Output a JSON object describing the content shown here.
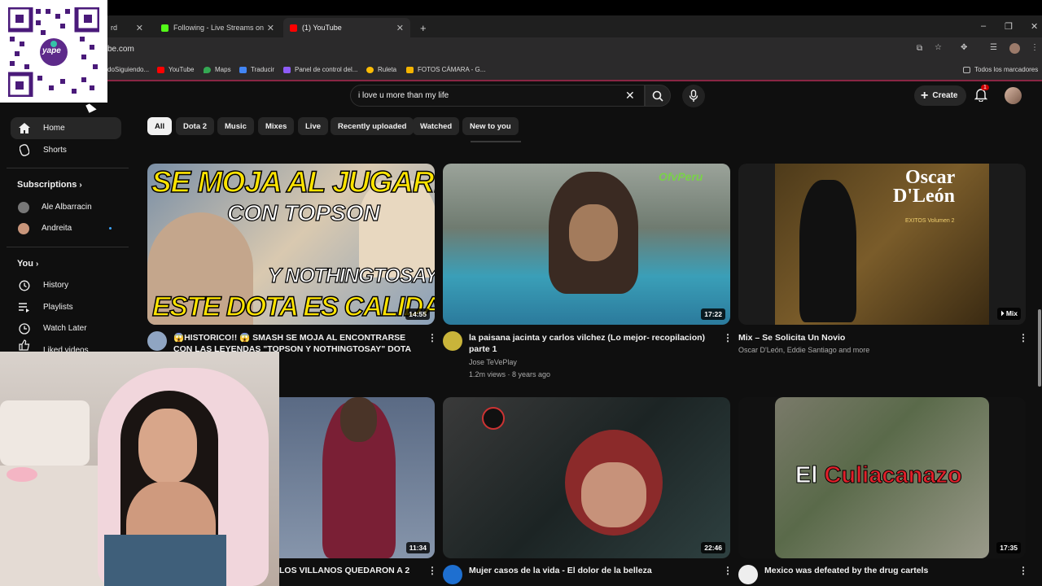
{
  "browser": {
    "tabs": [
      {
        "label": "rd",
        "active": false
      },
      {
        "label": "Following - Live Streams on Kic",
        "active": false
      },
      {
        "label": "(1) YouTube",
        "active": true
      }
    ],
    "new_tab": "+",
    "url": "be.com",
    "bookmarks": [
      {
        "label": "doSiguiendo...",
        "color": "#888888"
      },
      {
        "label": "YouTube",
        "color": "#ff0000"
      },
      {
        "label": "Maps",
        "color": "#34a853"
      },
      {
        "label": "Traducir",
        "color": "#4285f4"
      },
      {
        "label": "Panel de control del...",
        "color": "#8e5cf7"
      },
      {
        "label": "Ruleta",
        "color": "#fbbc05"
      },
      {
        "label": "FOTOS CÁMARA - G...",
        "color": "#f4b400"
      }
    ],
    "all_bookmarks": "Todos los marcadores",
    "window": {
      "minimize": "–",
      "restore": "❐",
      "close": "✕"
    }
  },
  "youtube": {
    "search_value": "i love u more than my life",
    "create_label": "Create",
    "notification_count": "1",
    "chips": [
      "All",
      "Dota 2",
      "Music",
      "Mixes",
      "Live",
      "Recently uploaded",
      "Watched",
      "New to you"
    ],
    "sidebar": {
      "home": "Home",
      "shorts": "Shorts",
      "subscriptions_header": "Subscriptions",
      "subscriptions": [
        "Ale Albarracin",
        "Andreita"
      ],
      "you_header": "You",
      "you_items": [
        "History",
        "Playlists",
        "Watch Later",
        "Liked videos"
      ]
    },
    "videos": [
      {
        "title": "😱HISTORICO!! 😱 SMASH SE MOJA AL ENCONTRARSE CON LAS LEYENDAS \"TOPSON Y NOTHINGTOSAY\" DOTA DE ...",
        "duration": "14:55",
        "thumb_line1": "SE MOJA AL JUGAR!!",
        "thumb_line2": "CON TOPSON",
        "thumb_line3": "Y NOTHINGTOSAY",
        "thumb_line4": "ESTE DOTA ES CALIDAD"
      },
      {
        "title": "la paisana jacinta y carlos vilchez (Lo mejor- recopilacion) parte 1",
        "channel": "Jose TeVePlay",
        "stats": "1.2m views · 8 years ago",
        "duration": "17:22",
        "thumb_logo": "OfvPeru"
      },
      {
        "title": "Mix – Se Solicita Un Novio",
        "channel": "Oscar D'León, Eddie Santiago and more",
        "badge": "Mix",
        "thumb_line1": "Oscar",
        "thumb_line2": "D'León",
        "thumb_line3": "EXITOS Volumen 2"
      },
      {
        "title": "LOS VILLANOS QUEDARON A 2",
        "duration": "11:34"
      },
      {
        "title": "Mujer casos de la vida - El dolor de la belleza",
        "duration": "22:46"
      },
      {
        "title": "Mexico was defeated by the drug cartels",
        "duration": "17:35",
        "thumb_word1": "El",
        "thumb_word2": "Culiacanazo"
      }
    ]
  },
  "overlay": {
    "qr_label": "yape"
  },
  "colors": {
    "background": "#0f0f0f",
    "chip_bg": "#272727",
    "accent_red": "#ff0000",
    "bookmark_border": "#8a2644"
  }
}
